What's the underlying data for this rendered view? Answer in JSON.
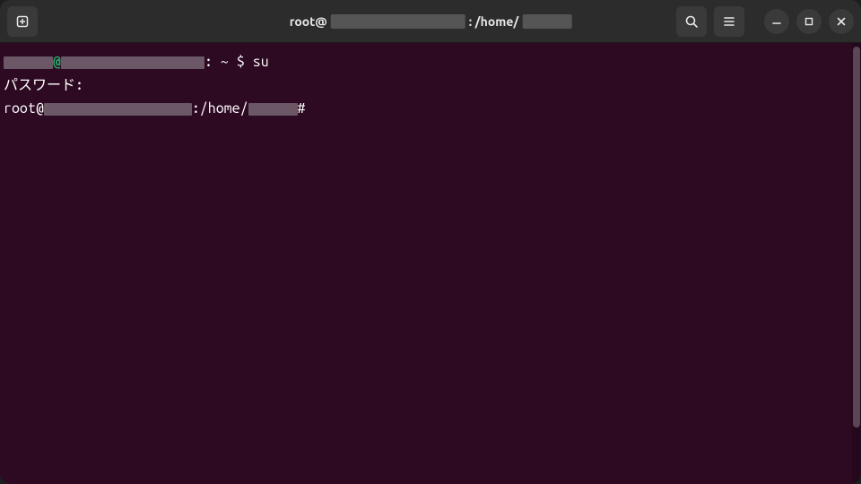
{
  "titlebar": {
    "title_prefix": "root@",
    "title_mid": ": /home/"
  },
  "terminal": {
    "line1": {
      "at": "@",
      "colon": ":",
      "tilde": "~",
      "dollar": "$",
      "command": "su"
    },
    "line2": "パスワード:",
    "line3": {
      "prefix": "root@",
      "mid": ":/home/",
      "prompt": "#"
    }
  }
}
